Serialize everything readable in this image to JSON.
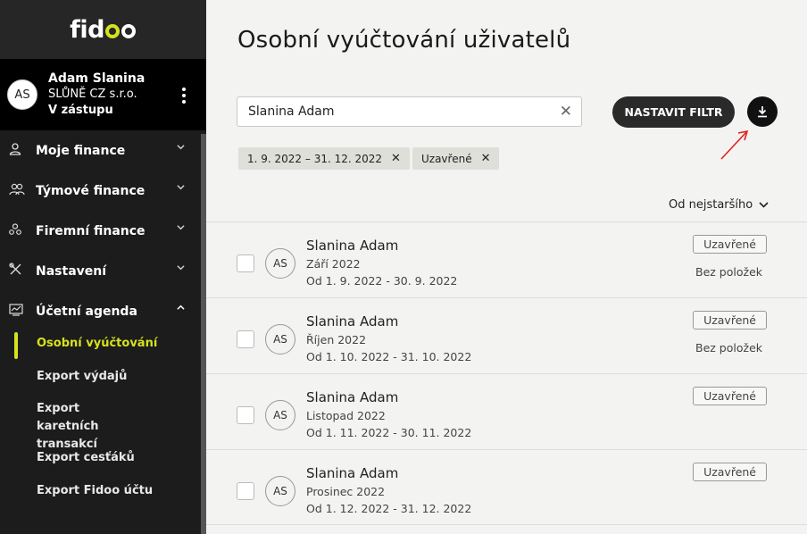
{
  "brand": {
    "logo": "fidoo"
  },
  "user": {
    "initials": "AS",
    "name": "Adam Slanina",
    "company": "SLŮNĚ CZ s.r.o.",
    "role": "V zástupu"
  },
  "nav": {
    "items": [
      {
        "label": "Moje finance",
        "icon": "person-icon"
      },
      {
        "label": "Týmové finance",
        "icon": "team-icon"
      },
      {
        "label": "Firemní finance",
        "icon": "company-icon"
      },
      {
        "label": "Nastavení",
        "icon": "tools-icon"
      },
      {
        "label": "Účetní agenda",
        "icon": "accounting-icon"
      }
    ],
    "sub": [
      "Osobní vyúčtování",
      "Export výdajů",
      "Export karetních transakcí",
      "Export cesťáků",
      "Export Fidoo účtu"
    ]
  },
  "page": {
    "title": "Osobní vyúčtování uživatelů"
  },
  "search": {
    "value": "Slanina Adam",
    "clear": "✕"
  },
  "toolbar": {
    "filter_label": "NASTAVIT FILTR",
    "download_icon": "download-icon"
  },
  "chips": [
    {
      "label": "1. 9. 2022 – 31. 12. 2022",
      "remove": "✕"
    },
    {
      "label": "Uzavřené",
      "remove": "✕"
    }
  ],
  "sort": {
    "label": "Od nejstaršího"
  },
  "rows": [
    {
      "initials": "AS",
      "name": "Slanina Adam",
      "period": "Září 2022",
      "range": "Od 1. 9. 2022 - 30. 9. 2022",
      "status": "Uzavřené",
      "note": "Bez položek"
    },
    {
      "initials": "AS",
      "name": "Slanina Adam",
      "period": "Říjen 2022",
      "range": "Od 1. 10. 2022 - 31. 10. 2022",
      "status": "Uzavřené",
      "note": "Bez položek"
    },
    {
      "initials": "AS",
      "name": "Slanina Adam",
      "period": "Listopad 2022",
      "range": "Od 1. 11. 2022 - 30. 11. 2022",
      "status": "Uzavřené",
      "note": ""
    },
    {
      "initials": "AS",
      "name": "Slanina Adam",
      "period": "Prosinec 2022",
      "range": "Od 1. 12. 2022 - 31. 12. 2022",
      "status": "Uzavřené",
      "note": ""
    }
  ],
  "colors": {
    "accent": "#d6e21c",
    "sidebar": "#1c1c1c",
    "annotation_arrow": "#e02020"
  }
}
